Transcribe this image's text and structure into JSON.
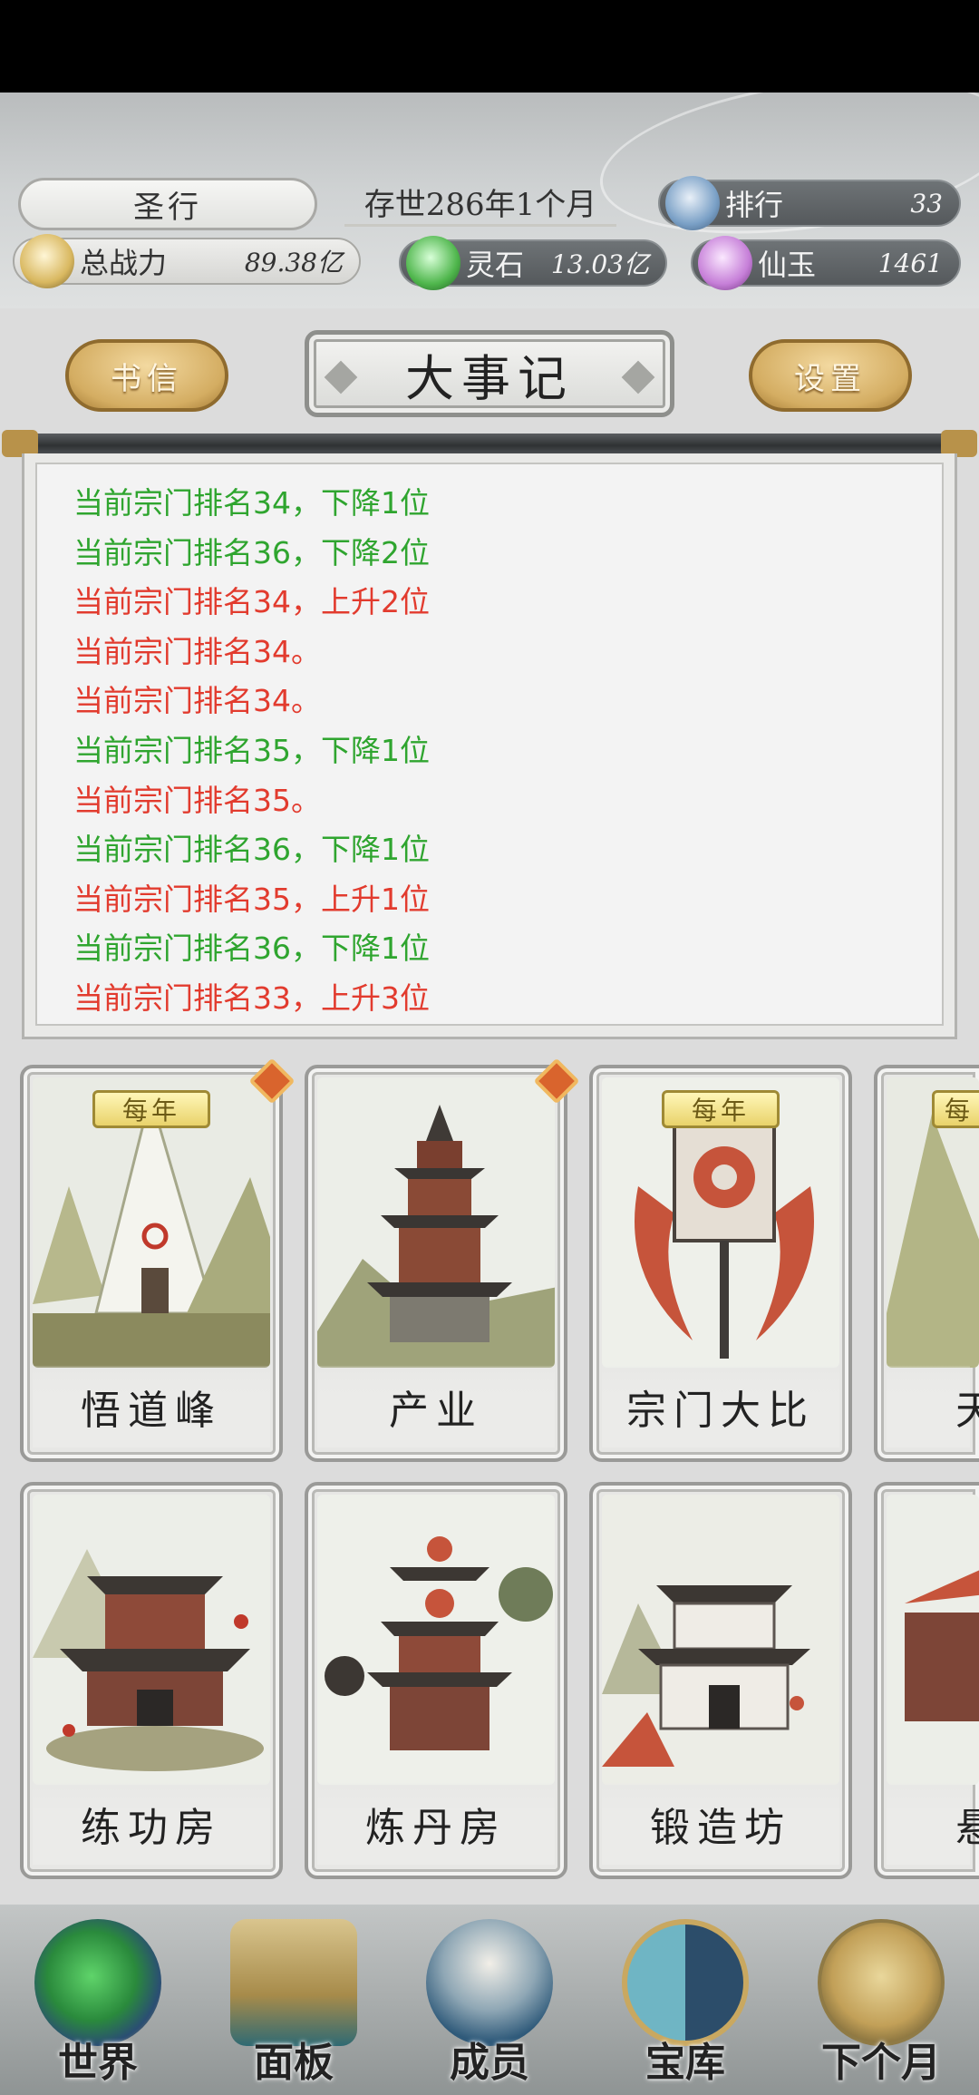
{
  "hud": {
    "sect_name": "圣行",
    "age": "存世286年1个月",
    "rank": {
      "label": "排行",
      "value": "33"
    },
    "power": {
      "label": "总战力",
      "value": "89.38亿"
    },
    "spirit_stone": {
      "label": "灵石",
      "value": "13.03亿"
    },
    "immortal_jade": {
      "label": "仙玉",
      "value": "1461"
    }
  },
  "toolbar": {
    "letters_label": "书信",
    "title": "大事记",
    "settings_label": "设置"
  },
  "log": [
    {
      "text": "当前宗门排名34，下降1位",
      "color": "#2fa52f"
    },
    {
      "text": "当前宗门排名36，下降2位",
      "color": "#2fa52f"
    },
    {
      "text": "当前宗门排名34，上升2位",
      "color": "#e23b2e"
    },
    {
      "text": "当前宗门排名34。",
      "color": "#e23b2e"
    },
    {
      "text": "当前宗门排名34。",
      "color": "#e23b2e"
    },
    {
      "text": "当前宗门排名35，下降1位",
      "color": "#2fa52f"
    },
    {
      "text": "当前宗门排名35。",
      "color": "#e23b2e"
    },
    {
      "text": "当前宗门排名36，下降1位",
      "color": "#2fa52f"
    },
    {
      "text": "当前宗门排名35，上升1位",
      "color": "#e23b2e"
    },
    {
      "text": "当前宗门排名36，下降1位",
      "color": "#2fa52f"
    },
    {
      "text": "当前宗门排名33，上升3位",
      "color": "#e23b2e"
    }
  ],
  "buildings": {
    "row1": [
      {
        "name": "悟道峰",
        "badge": "每年",
        "alert": true
      },
      {
        "name": "产业",
        "badge": "",
        "alert": true
      },
      {
        "name": "宗门大比",
        "badge": "每年",
        "alert": false
      },
      {
        "name": "天",
        "badge": "每",
        "alert": false
      }
    ],
    "row2": [
      {
        "name": "练功房"
      },
      {
        "name": "炼丹房"
      },
      {
        "name": "锻造坊"
      },
      {
        "name": "悬"
      }
    ]
  },
  "nav": [
    {
      "label": "世界",
      "icon": "world-icon"
    },
    {
      "label": "面板",
      "icon": "scroll-icon"
    },
    {
      "label": "成员",
      "icon": "member-icon"
    },
    {
      "label": "宝库",
      "icon": "treasury-icon"
    },
    {
      "label": "下个月",
      "icon": "next-month-icon"
    }
  ],
  "colors": {
    "gain": "#e23b2e",
    "loss": "#2fa52f",
    "gold": "#d4ad62"
  }
}
